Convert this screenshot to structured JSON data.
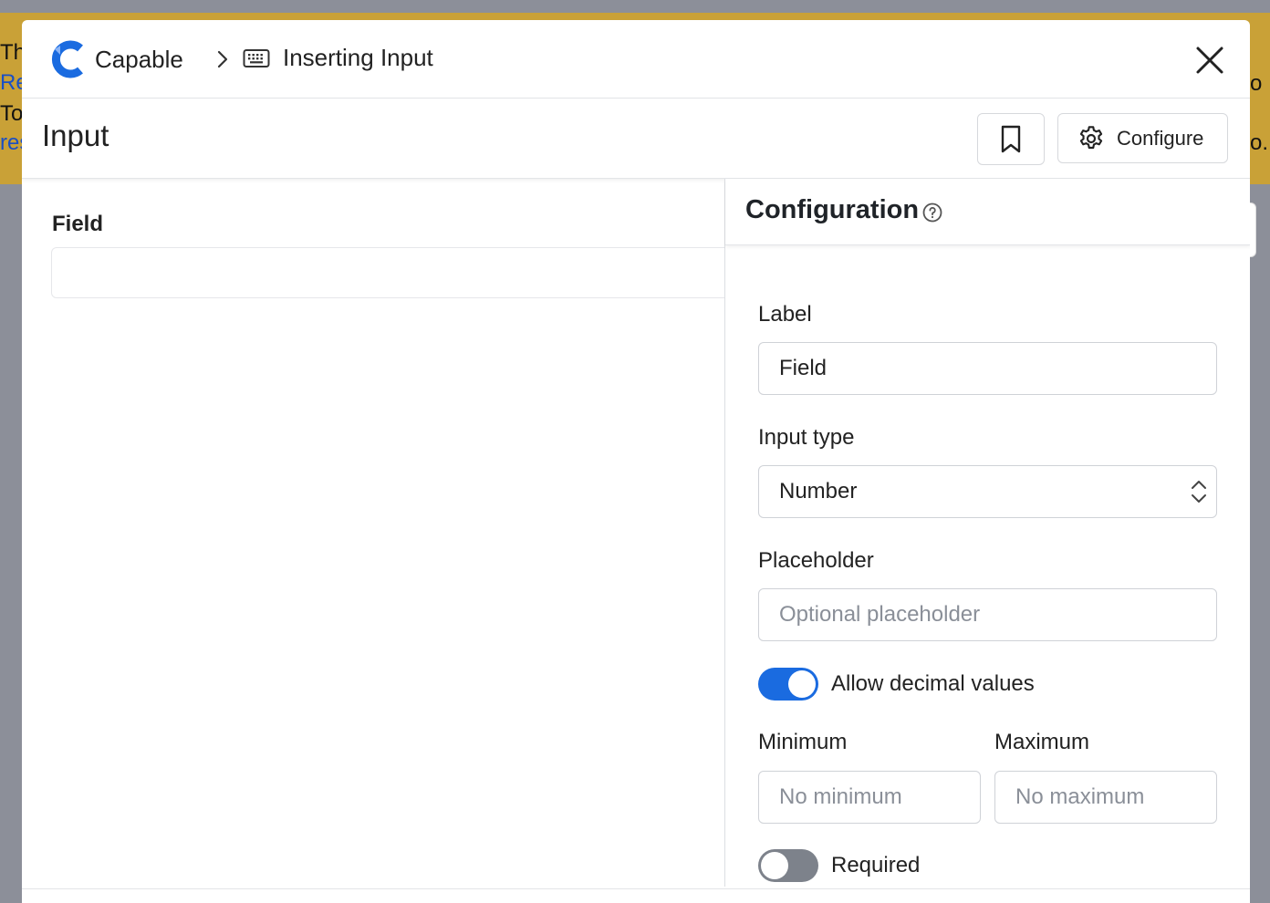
{
  "background": {
    "fragments_left": [
      "Th",
      "Re",
      "To",
      "res"
    ],
    "fragments_right": [
      "o",
      "o."
    ]
  },
  "breadcrumb": {
    "app_name": "Capable",
    "current": "Inserting Input"
  },
  "header": {
    "title": "Input",
    "configure_label": "Configure"
  },
  "preview": {
    "field_label": "Field",
    "field_value": ""
  },
  "configuration": {
    "title": "Configuration",
    "label_label": "Label",
    "label_value": "Field",
    "input_type_label": "Input type",
    "input_type_value": "Number",
    "placeholder_label": "Placeholder",
    "placeholder_placeholder": "Optional placeholder",
    "allow_decimal_label": "Allow decimal values",
    "allow_decimal_on": true,
    "minimum_label": "Minimum",
    "minimum_placeholder": "No minimum",
    "maximum_label": "Maximum",
    "maximum_placeholder": "No maximum",
    "required_label": "Required",
    "required_on": false
  },
  "colors": {
    "brand_blue": "#1a6be0",
    "toggle_on": "#1a6be0",
    "toggle_off": "#7d828b",
    "banner": "#c9a137"
  },
  "icons": {
    "brand": "capable-logo-icon",
    "separator": "chevron-right-icon",
    "crumb": "keyboard-icon",
    "close": "close-icon",
    "bookmark": "bookmark-icon",
    "configure": "gear-icon",
    "help": "help-circle-icon",
    "select": "chevron-updown-icon"
  }
}
